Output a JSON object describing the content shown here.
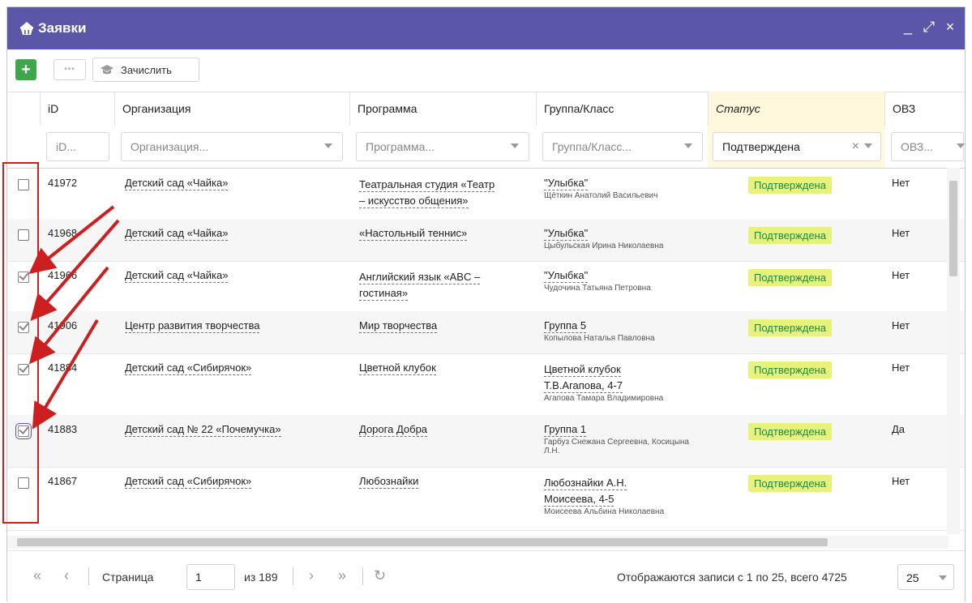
{
  "window": {
    "title": "Заявки",
    "controls": [
      "_",
      "⤢",
      "×"
    ]
  },
  "toolbar": {
    "add_label": "+",
    "more_label": "•••",
    "enroll_label": "Зачислить"
  },
  "columns": [
    {
      "label": "iD",
      "filter_placeholder": "iD..."
    },
    {
      "label": "Организация",
      "filter_placeholder": "Организация..."
    },
    {
      "label": "Программа",
      "filter_placeholder": "Программа..."
    },
    {
      "label": "Группа/Класс",
      "filter_placeholder": "Группа/Класс..."
    },
    {
      "label": "Статус",
      "filter_value": "Подтверждена"
    },
    {
      "label": "ОВЗ",
      "filter_placeholder": "ОВЗ..."
    }
  ],
  "rows": [
    {
      "checked": false,
      "id": "41972",
      "org": "Детский сад «Чайка»",
      "program": [
        "Театральная студия «Театр",
        "– искусство общения»"
      ],
      "group": [
        "\"Улыбка\""
      ],
      "teacher": "Щёткин Анатолий Васильевич",
      "status": "Подтверждена",
      "ovz": "Нет"
    },
    {
      "checked": false,
      "id": "41968",
      "org": "Детский сад «Чайка»",
      "program": [
        "«Настольный теннис»"
      ],
      "group": [
        "\"Улыбка\""
      ],
      "teacher": "Цыбульская Ирина Николаевна",
      "status": "Подтверждена",
      "ovz": "Нет"
    },
    {
      "checked": true,
      "id": "41966",
      "org": "Детский сад «Чайка»",
      "program": [
        "Английский язык «ABC –",
        "гостиная»"
      ],
      "group": [
        "\"Улыбка\""
      ],
      "teacher": "Чудочина Татьяна Петровна",
      "status": "Подтверждена",
      "ovz": "Нет"
    },
    {
      "checked": true,
      "id": "41906",
      "org": "Центр развития творчества",
      "program": [
        "Мир творчества"
      ],
      "group": [
        "Группа 5"
      ],
      "teacher": "Копылова Наталья Павловна",
      "status": "Подтверждена",
      "ovz": "Нет"
    },
    {
      "checked": true,
      "id": "41884",
      "org": "Детский сад «Сибирячок»",
      "program": [
        "Цветной клубок"
      ],
      "group": [
        "Цветной клубок",
        "Т.В.Агапова, 4-7"
      ],
      "teacher": "Агапова Тамара Владимировна",
      "status": "Подтверждена",
      "ovz": "Нет"
    },
    {
      "checked": true,
      "id": "41883",
      "org": "Детский сад № 22 «Почемучка»",
      "program": [
        "Дорога Добра"
      ],
      "group": [
        "Группа 1"
      ],
      "teacher": "Гарбуз Снежана Сергеевна, Косицына Л.Н.",
      "status": "Подтверждена",
      "ovz": "Да"
    },
    {
      "checked": false,
      "id": "41867",
      "org": "Детский сад «Сибирячок»",
      "program": [
        "Любознайки"
      ],
      "group": [
        "Любознайки А.Н.",
        "Моисеева, 4-5"
      ],
      "teacher": "Моисеева Альбина Николаевна",
      "status": "Подтверждена",
      "ovz": "Нет"
    }
  ],
  "pager": {
    "page_label": "Страница",
    "page_value": "1",
    "of_label": "из 189",
    "summary": "Отображаются записи с 1 по 25, всего 4725",
    "page_size": "25"
  },
  "colors": {
    "titlebar": "#5a56a8",
    "add": "#3da84a",
    "badge_bg": "#e8f27a",
    "badge_text": "#1a8a4a",
    "highlight": "#cc1f1f"
  }
}
